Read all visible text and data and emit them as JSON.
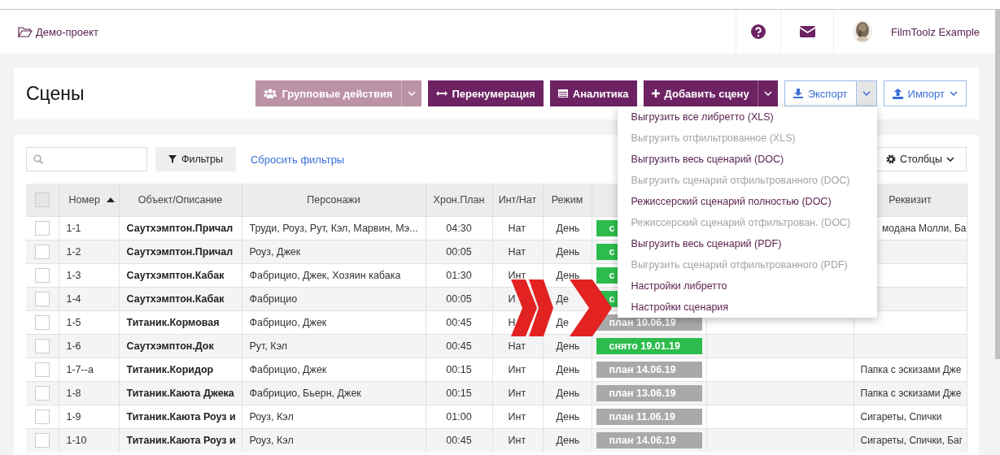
{
  "header": {
    "project": "Демо-проект",
    "user": "FilmToolz Example"
  },
  "page": {
    "title": "Сцены"
  },
  "actions": {
    "group_actions": {
      "label": "Групповые действия",
      "disabled": true
    },
    "renumber": {
      "label": "Перенумерация"
    },
    "analytics": {
      "label": "Аналитика"
    },
    "add_scene": {
      "label": "Добавить сцену"
    },
    "export": {
      "label": "Экспорт",
      "expanded": true
    },
    "import": {
      "label": "Импорт"
    }
  },
  "export_menu": [
    {
      "label": "Выгрузить все либретто (XLS)",
      "disabled": false
    },
    {
      "label": "Выгрузить отфильтрованное (XLS)",
      "disabled": true
    },
    {
      "label": "Выгрузить весь сценарий (DOC)",
      "disabled": false
    },
    {
      "label": "Выгрузить сценарий отфильтрованного (DOC)",
      "disabled": true
    },
    {
      "label": "Режиссерский сценарий полностью (DOC)",
      "disabled": false
    },
    {
      "label": "Режиссерский сценарий отфильтрован. (DOC)",
      "disabled": true
    },
    {
      "label": "Выгрузить весь сценарий (PDF)",
      "disabled": false
    },
    {
      "label": "Выгрузить сценарий отфильтрованного (PDF)",
      "disabled": true
    },
    {
      "label": "Настройки либретто",
      "disabled": false
    },
    {
      "label": "Настройки сценария",
      "disabled": false
    }
  ],
  "toolbar": {
    "filters": "Фильтры",
    "reset": "Сбросить фильтры",
    "columns": "Столбцы"
  },
  "table": {
    "all_selected": false,
    "columns": [
      "Номер",
      "Объект/Описание",
      "Персонажи",
      "Хрон.План",
      "Инт/Нат",
      "Режим",
      "Реквизит"
    ],
    "rows": [
      {
        "checked": false,
        "number": "1-1",
        "object": "Саутхэмптон.Причал",
        "characters": "Труди, Роуз, Рут, Кэл, Марвин, Мэ...",
        "duration": "04:30",
        "int_ext": "Нат",
        "mode": "День",
        "status": {
          "kind": "shot",
          "text": "с"
        },
        "props": "модана Молли, Ба"
      },
      {
        "checked": false,
        "number": "1-2",
        "object": "Саутхэмптон.Причал",
        "characters": "Роуз, Джек",
        "duration": "00:05",
        "int_ext": "Нат",
        "mode": "День",
        "status": {
          "kind": "shot",
          "text": "с"
        }
      },
      {
        "checked": false,
        "number": "1-3",
        "object": "Саутхэмптон.Кабак",
        "characters": "Фабрицио, Джек, Хозяин кабака",
        "duration": "01:30",
        "int_ext": "Инт",
        "mode": "День",
        "status": {
          "kind": "shot",
          "text": "с"
        }
      },
      {
        "checked": false,
        "number": "1-4",
        "object": "Саутхэмптон.Кабак",
        "characters": "Фабрицио",
        "duration": "00:05",
        "int_ext": "И",
        "mode": "Де",
        "status": {
          "kind": "shot",
          "text": "с"
        }
      },
      {
        "checked": false,
        "number": "1-5",
        "object": "Титаник.Кормовая",
        "characters": "Фабрицио, Джек",
        "duration": "00:45",
        "int_ext": "Н",
        "mode": "Де",
        "status": {
          "kind": "plan",
          "text": "план 10.06.19"
        }
      },
      {
        "checked": false,
        "number": "1-6",
        "object": "Саутхэмптон.Док",
        "characters": "Рут, Кэл",
        "duration": "00:45",
        "int_ext": "Нат",
        "mode": "День",
        "status": {
          "kind": "shot",
          "text": "снято 19.01.19"
        }
      },
      {
        "checked": false,
        "number": "1-7--а",
        "object": "Титаник.Коридор",
        "characters": "Фабрицио, Джек",
        "duration": "00:15",
        "int_ext": "Инт",
        "mode": "День",
        "status": {
          "kind": "plan",
          "text": "план 14.06.19"
        },
        "props": "Папка с эскизами Дже"
      },
      {
        "checked": false,
        "number": "1-8",
        "object": "Титаник.Каюта Джека",
        "characters": "Фабрицио, Бьерн, Джек",
        "duration": "00:15",
        "int_ext": "Инт",
        "mode": "День",
        "status": {
          "kind": "plan",
          "text": "план 13.06.19"
        },
        "props": "Папка с эскизами Дже"
      },
      {
        "checked": false,
        "number": "1-9",
        "object": "Титаник.Каюта Роуз и",
        "characters": "Роуз, Кэл",
        "duration": "01:00",
        "int_ext": "Инт",
        "mode": "День",
        "status": {
          "kind": "plan",
          "text": "план 11.06.19"
        },
        "props": "Сигареты, Спички"
      },
      {
        "checked": false,
        "number": "1-10",
        "object": "Титаник.Каюта Роуз и",
        "characters": "Роуз, Кэл",
        "duration": "00:45",
        "int_ext": "Инт",
        "mode": "День",
        "status": {
          "kind": "plan",
          "text": "план 14.06.19"
        },
        "props": "Сигареты, Спички, Баг"
      }
    ]
  }
}
